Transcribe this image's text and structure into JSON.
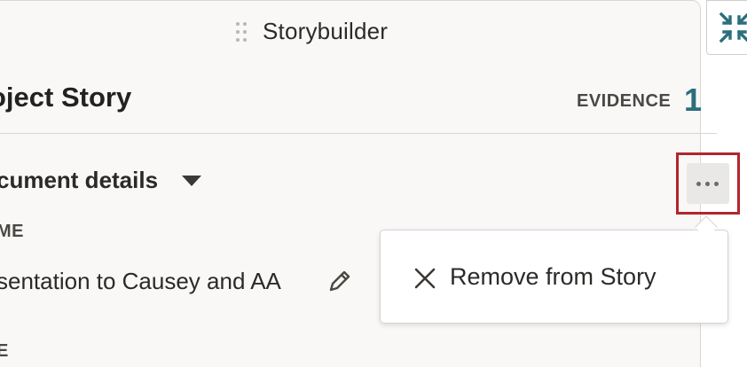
{
  "panel": {
    "title": "Storybuilder",
    "story_title": "oject Story",
    "evidence_label": "EVIDENCE",
    "evidence_count": "1"
  },
  "section": {
    "title": "cument details",
    "field_label": "ME",
    "field_value": "sentation to Causey and AA",
    "field_label_2": "E"
  },
  "menu": {
    "items": [
      {
        "label": "Remove from Story",
        "icon": "close-icon"
      }
    ]
  },
  "icons": {
    "drag": "drag-handle-icon",
    "collapse": "collapse-icon",
    "caret": "caret-down-icon",
    "edit": "pencil-icon",
    "more": "more-options-icon"
  },
  "colors": {
    "accent": "#2b6f7d",
    "highlight": "#b1262c",
    "panel_bg": "#f9f8f7"
  }
}
